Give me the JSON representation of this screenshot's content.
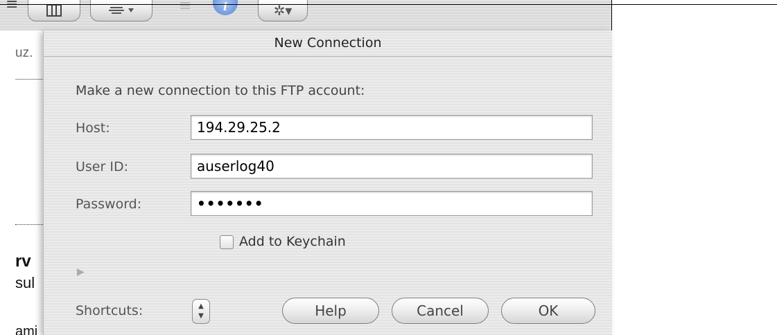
{
  "dialog": {
    "title": "New Connection",
    "prompt": "Make a new connection to this FTP account:",
    "host_label": "Host:",
    "host_value": "194.29.25.2",
    "user_label": "User ID:",
    "user_value": "auserlog40",
    "password_label": "Password:",
    "password_value": "•••••••",
    "keychain_label": "Add to Keychain",
    "keychain_checked": false,
    "shortcuts_label": "Shortcuts:",
    "help_label": "Help",
    "cancel_label": "Cancel",
    "ok_label": "OK"
  },
  "background": {
    "line1": "uz.",
    "line2": "rv",
    "line3": "sul",
    "line4": "ami"
  },
  "icons": {
    "list_view": "list-view-icon",
    "column_view": "column-view-icon",
    "arrange": "arrange-icon",
    "info": "info-icon",
    "action": "gear-icon"
  },
  "colors": {
    "sheet_bg": "#ececec",
    "info_blue": "#5a86d6"
  }
}
